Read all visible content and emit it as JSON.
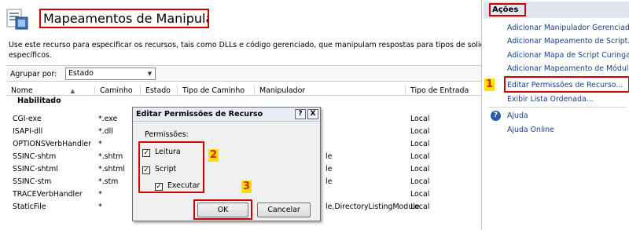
{
  "main": {
    "title": "Mapeamentos de Manipulador",
    "description_lines": [
      "Use este recurso para especificar os recursos, tais como DLLs e código gerenciado, que manipulam respostas para tipos de solicitações",
      "específicos."
    ],
    "group_by_label": "Agrupar por:",
    "group_by_value": "Estado",
    "columns": [
      "Nome",
      "Caminho",
      "Estado",
      "Tipo de Caminho",
      "Manipulador",
      "Tipo de Entrada"
    ],
    "group_heading": "Habilitado",
    "rows": [
      {
        "name": "CGI-exe",
        "path": "*.exe",
        "handler": "",
        "entry": "Local"
      },
      {
        "name": "ISAPI-dll",
        "path": "*.dll",
        "handler": "",
        "entry": "Local"
      },
      {
        "name": "OPTIONSVerbHandler",
        "path": "*",
        "handler": "",
        "entry": "Local"
      },
      {
        "name": "SSINC-shtm",
        "path": "*.shtm",
        "handler": "le",
        "entry": "Local"
      },
      {
        "name": "SSINC-shtml",
        "path": "*.shtml",
        "handler": "le",
        "entry": "Local"
      },
      {
        "name": "SSINC-stm",
        "path": "*.stm",
        "handler": "le",
        "entry": "Local"
      },
      {
        "name": "TRACEVerbHandler",
        "path": "*",
        "handler": "",
        "entry": "Local"
      },
      {
        "name": "StaticFile",
        "path": "*",
        "handler": "le,DirectoryListingModule",
        "entry": "Local"
      }
    ]
  },
  "actions": {
    "title": "Ações",
    "items": [
      "Adicionar Manipulador Gerenciado...",
      "Adicionar Mapeamento de Script...",
      "Adicionar Mapa de Script Curinga...",
      "Adicionar Mapeamento de Módulo...",
      "Editar Permissões de Recurso...",
      "Exibir Lista Ordenada..."
    ],
    "help": [
      "Ajuda",
      "Ajuda Online"
    ]
  },
  "dialog": {
    "title": "Editar Permissões de Recurso",
    "help_btn": "?",
    "close_btn": "X",
    "permissions_label": "Permissões:",
    "read_label": "Leitura",
    "script_label": "Script",
    "execute_label": "Executar",
    "read_checked": true,
    "script_checked": true,
    "execute_checked": true,
    "ok_label": "OK",
    "cancel_label": "Cancelar"
  },
  "markers": [
    "1",
    "2",
    "3"
  ],
  "colors": {
    "highlight_red": "#d40000",
    "marker_yellow": "#ffdd00",
    "link_blue": "#15428b"
  }
}
